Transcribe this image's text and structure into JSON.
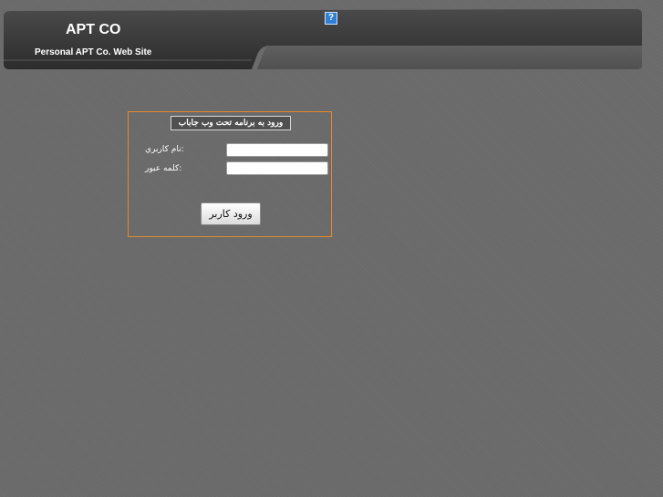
{
  "header": {
    "brand": "APT CO",
    "tagline": "Personal APT Co. Web Site",
    "help_icon": "help-icon"
  },
  "login": {
    "title": "ورود به برنامه تحت وب جاباب",
    "username_label": ":نام کاربري",
    "password_label": ":کلمه عبور",
    "username_value": "",
    "password_value": "",
    "submit_label": "ورود کاربر"
  },
  "colors": {
    "background": "#6a6a6a",
    "header": "#3e3e3e",
    "box_border": "#e08a2c",
    "help_icon": "#2f7fd8"
  }
}
